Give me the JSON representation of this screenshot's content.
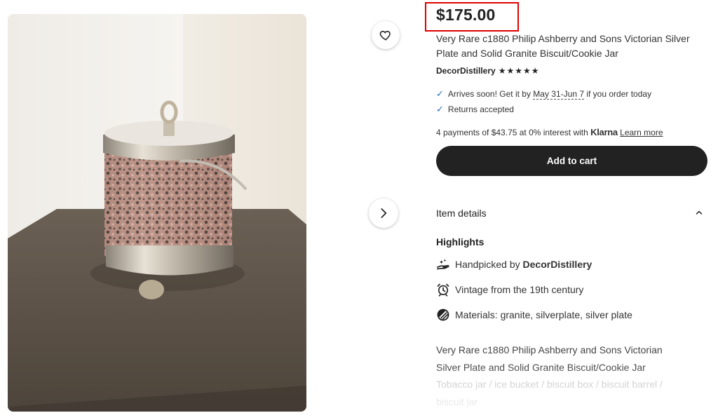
{
  "product": {
    "price": "$175.00",
    "title": "Very Rare c1880 Philip Ashberry and Sons Victorian Silver Plate and Solid Granite Biscuit/Cookie Jar",
    "shop_name": "DecorDistillery",
    "stars": "★★★★★",
    "rating_stars": 5
  },
  "delivery": {
    "arrives_prefix": "Arrives soon! Get it by",
    "arrives_dates": "May 31-Jun 7",
    "arrives_suffix": "if you order today",
    "returns": "Returns accepted"
  },
  "payments": {
    "prefix": "4 payments of $43.75 at 0% interest with",
    "provider": "Klarna",
    "link": "Learn more"
  },
  "actions": {
    "add_to_cart": "Add to cart"
  },
  "details": {
    "heading": "Item details",
    "highlights_heading": "Highlights",
    "handpicked_prefix": "Handpicked by",
    "handpicked_shop": "DecorDistillery",
    "vintage": "Vintage from the 19th century",
    "materials": "Materials: granite, silverplate, silver plate"
  },
  "description": {
    "line1": "Very Rare c1880 Philip Ashberry and Sons Victorian",
    "line2": "Silver Plate and Solid Granite Biscuit/Cookie Jar",
    "line3": "Tobacco jar / ice bucket / biscuit box / biscuit barrel /",
    "line4": "biscuit jar"
  },
  "colors": {
    "price_highlight": "#e00000",
    "check": "#2b6cc4",
    "button": "#222222"
  },
  "icons": [
    "heart-icon",
    "chevron-right-icon",
    "chevron-up-icon",
    "check-icon",
    "hand-icon",
    "clock-icon",
    "materials-icon"
  ]
}
